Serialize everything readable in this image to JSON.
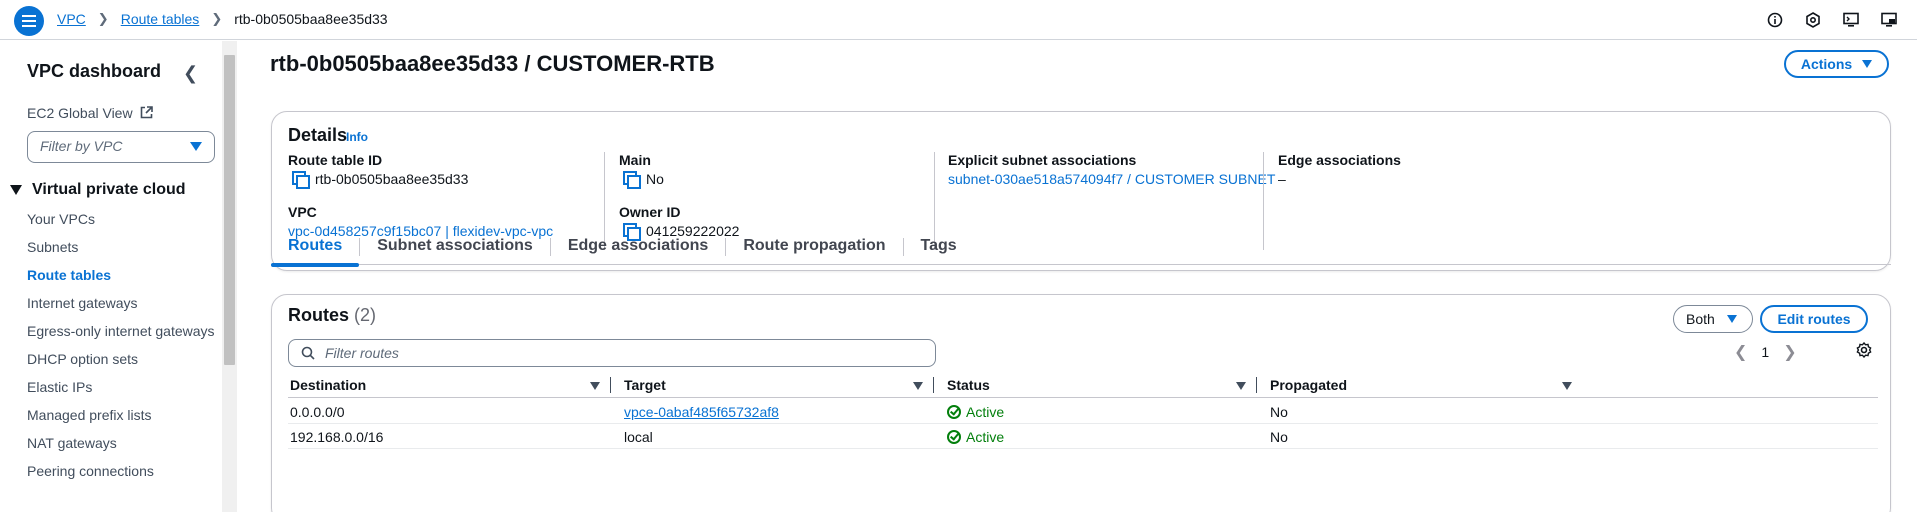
{
  "breadcrumb": {
    "items": [
      "VPC",
      "Route tables",
      "rtb-0b0505baa8ee35d33"
    ]
  },
  "sidebar": {
    "title": "VPC dashboard",
    "ec2_global_view": "EC2 Global View",
    "filter_placeholder": "Filter by VPC",
    "section": "Virtual private cloud",
    "items": [
      {
        "label": "Your VPCs"
      },
      {
        "label": "Subnets"
      },
      {
        "label": "Route tables"
      },
      {
        "label": "Internet gateways"
      },
      {
        "label": "Egress-only internet gateways"
      },
      {
        "label": "DHCP option sets"
      },
      {
        "label": "Elastic IPs"
      },
      {
        "label": "Managed prefix lists"
      },
      {
        "label": "NAT gateways"
      },
      {
        "label": "Peering connections"
      }
    ]
  },
  "page": {
    "title": "rtb-0b0505baa8ee35d33 / CUSTOMER-RTB",
    "actions_label": "Actions"
  },
  "details": {
    "heading": "Details",
    "info": "Info",
    "route_table_id_label": "Route table ID",
    "route_table_id": "rtb-0b0505baa8ee35d33",
    "vpc_label": "VPC",
    "vpc": "vpc-0d458257c9f15bc07 | flexidev-vpc-vpc",
    "main_label": "Main",
    "main": "No",
    "owner_label": "Owner ID",
    "owner": "041259222022",
    "explicit_label": "Explicit subnet associations",
    "explicit": "subnet-030ae518a574094f7 / CUSTOMER SUBNET",
    "edge_label": "Edge associations",
    "edge": "–"
  },
  "tabs": [
    "Routes",
    "Subnet associations",
    "Edge associations",
    "Route propagation",
    "Tags"
  ],
  "routes": {
    "heading": "Routes",
    "count": "(2)",
    "both_label": "Both",
    "edit_label": "Edit routes",
    "filter_placeholder": "Filter routes",
    "page_number": "1",
    "columns": [
      "Destination",
      "Target",
      "Status",
      "Propagated"
    ],
    "rows": [
      {
        "destination": "0.0.0.0/0",
        "target": "vpce-0abaf485f65732af8",
        "status": "Active",
        "propagated": "No"
      },
      {
        "destination": "192.168.0.0/16",
        "target": "local",
        "status": "Active",
        "propagated": "No"
      }
    ]
  },
  "colors": {
    "accent": "#0972d3",
    "success": "#037f0c"
  }
}
